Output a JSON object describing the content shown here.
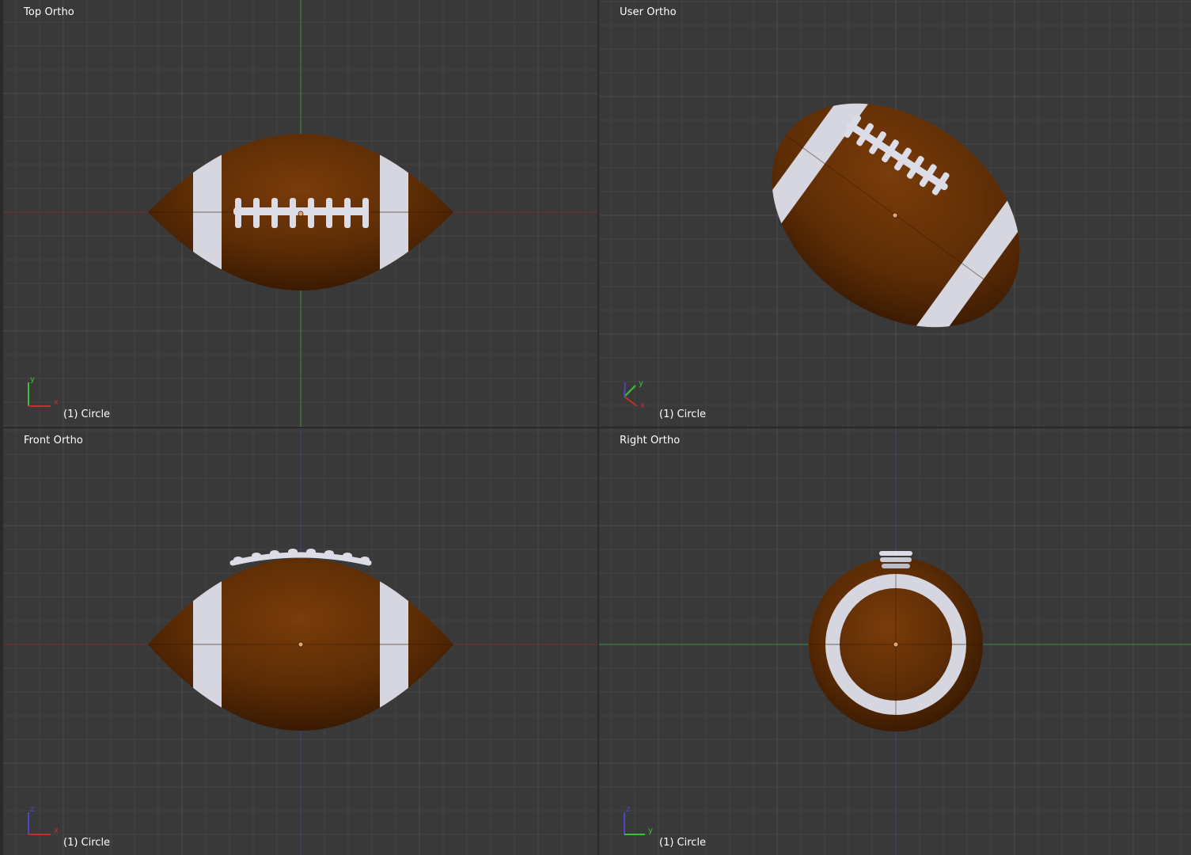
{
  "viewports": {
    "top": {
      "title": "Top Ortho",
      "object": "(1) Circle",
      "axes": [
        "y",
        "x"
      ]
    },
    "user": {
      "title": "User Ortho",
      "object": "(1) Circle",
      "axes": [
        "y",
        "x"
      ]
    },
    "front": {
      "title": "Front Ortho",
      "object": "(1) Circle",
      "axes": [
        "z",
        "x"
      ]
    },
    "right": {
      "title": "Right Ortho",
      "object": "(1) Circle",
      "axes": [
        "z",
        "y"
      ]
    }
  },
  "colors": {
    "background": "#393939",
    "grid_minor": "#444444",
    "grid_major": "#4d4d4d",
    "axis_x": "#8a2f2f",
    "axis_y": "#3f8f3f",
    "axis_z": "#3e3e8c",
    "ball_brown": "#6e3608",
    "stripe_white": "#d8d8e2",
    "origin_dot": "#f0a060"
  },
  "icons": [
    "axis-gizmo-icon",
    "object-origin-icon"
  ]
}
